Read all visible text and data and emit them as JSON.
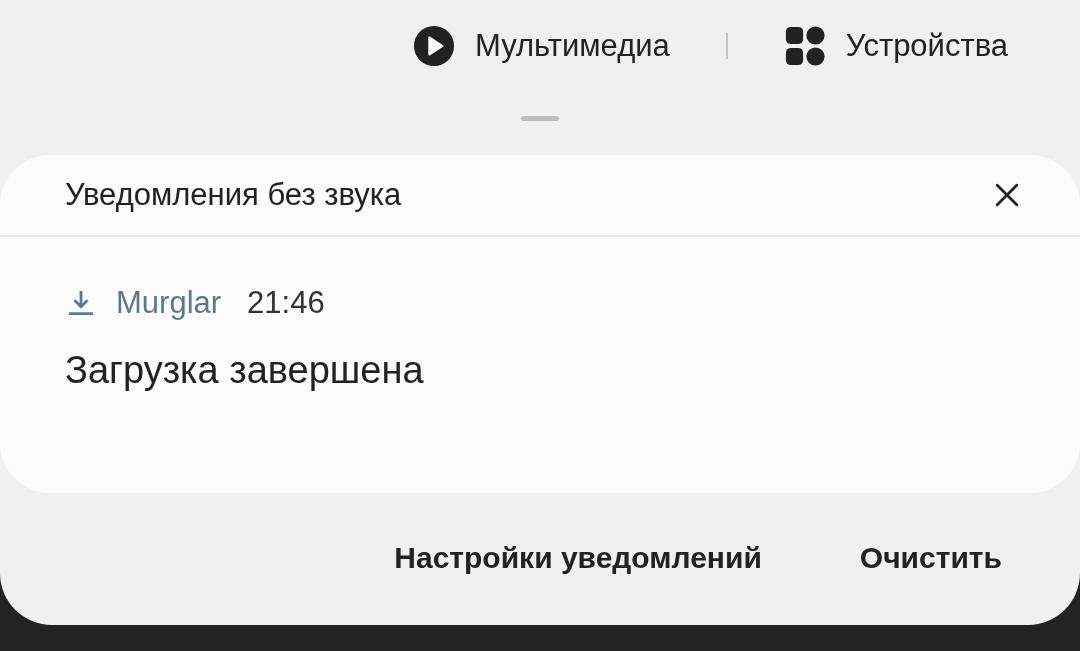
{
  "quick_tabs": [
    {
      "kind": "media",
      "label": "Мультимедиа"
    },
    {
      "kind": "devices",
      "label": "Устройства"
    }
  ],
  "notification_group": {
    "title": "Уведомления без звука",
    "notifications": [
      {
        "app": "Murglar",
        "time": "21:46",
        "text": "Загрузка завершена"
      }
    ]
  },
  "actions": [
    "Настройки уведомлений",
    "Очистить"
  ]
}
